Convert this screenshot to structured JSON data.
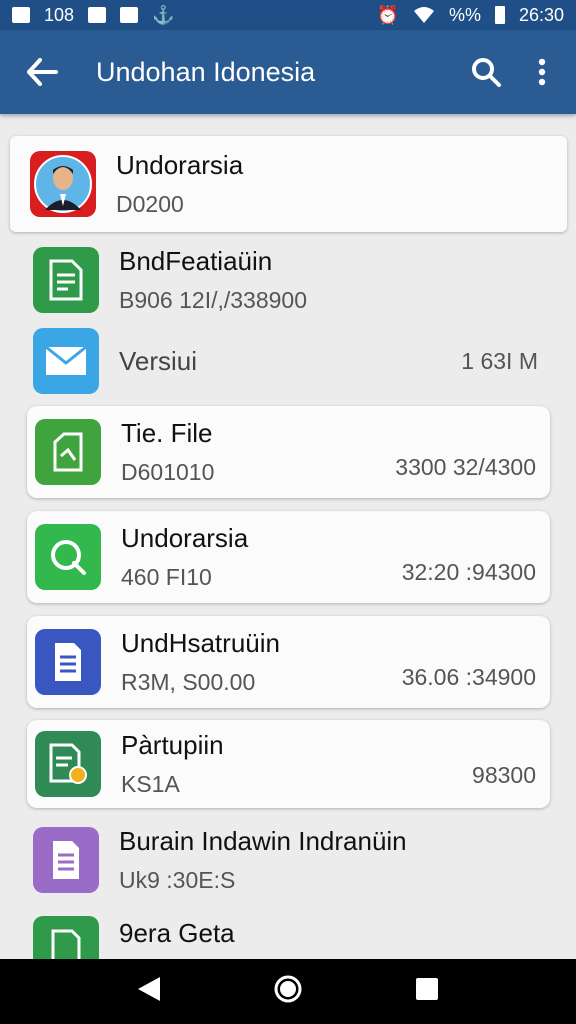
{
  "status_bar": {
    "left_text": "108",
    "battery_text": "%%",
    "time": "26:30"
  },
  "app_bar": {
    "title": "Undohan Idonesia"
  },
  "items": [
    {
      "name": "Undorarsia",
      "sub": "D0200",
      "trail": "",
      "icon": "avatar-icon",
      "color": "#d81e1e"
    },
    {
      "name": "BndFeatiaüin",
      "sub": "B906 12I/,/338900",
      "trail": "",
      "icon": "spreadsheet-icon",
      "color": "#2e9a4a"
    },
    {
      "name": "Versiui",
      "sub": "",
      "trail": "1 63I M",
      "icon": "mail-icon",
      "color": "#3aa6e6"
    },
    {
      "name": "Tie. File",
      "sub": "D601010",
      "trail": "3300 32/4300",
      "icon": "file-icon",
      "color": "#3fa33e"
    },
    {
      "name": "Undorarsia",
      "sub": "460 FI10",
      "trail": "32:20 :94300",
      "icon": "search-doc-icon",
      "color": "#33b84e"
    },
    {
      "name": "UndHsatruüin",
      "sub": "R3M, S00.00",
      "trail": "36.06 :34900",
      "icon": "document-icon",
      "color": "#3a56c0"
    },
    {
      "name": "Pàrtupiin",
      "sub": "KS1A",
      "trail": "98300",
      "icon": "doc-badge-icon",
      "color": "#2f8a55"
    },
    {
      "name": "Burain Indawin Indranüin",
      "sub": "Uk9 :30E:S",
      "trail": "",
      "icon": "notes-icon",
      "color": "#9a6bc7"
    },
    {
      "name": "9era Geta",
      "sub": "",
      "trail": "",
      "icon": "sheet-icon",
      "color": "#2e9a4a"
    }
  ]
}
